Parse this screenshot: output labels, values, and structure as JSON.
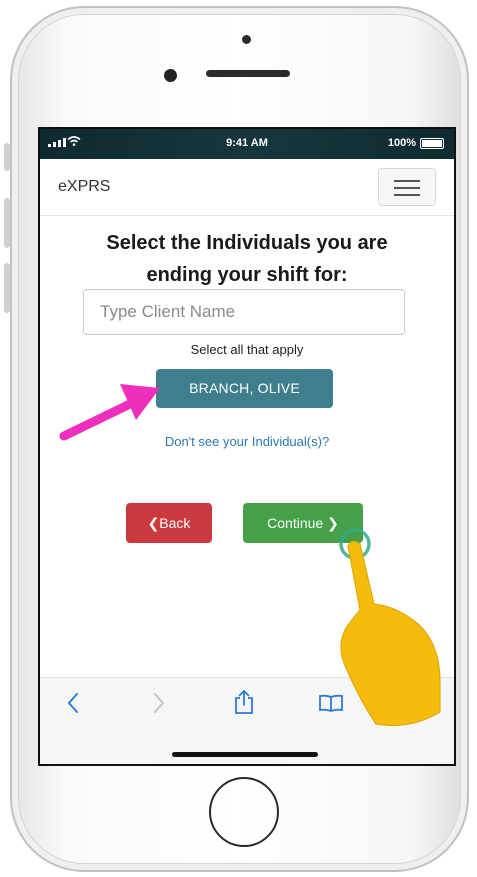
{
  "status_bar": {
    "time": "9:41 AM",
    "battery": "100%"
  },
  "navbar": {
    "brand": "eXPRS"
  },
  "page": {
    "title_line1": "Select the Individuals you are",
    "title_line2": "ending your shift for:",
    "search_placeholder": "Type Client Name",
    "hint": "Select all that apply",
    "client_button": "BRANCH, OLIVE",
    "missing_link": "Don't see your Individual(s)?",
    "back_label": "Back",
    "continue_label": "Continue"
  },
  "colors": {
    "client_button": "#3f7f8d",
    "back_button": "#c9393e",
    "continue_button": "#45a048",
    "link": "#2a78b8",
    "arrow_annotation": "#ee2fbe",
    "pointer_hand": "#f5bc0e"
  },
  "icons": {
    "toolbar": [
      "chevron-left-icon",
      "chevron-right-icon",
      "share-icon",
      "book-icon"
    ],
    "annotations": [
      "pink-arrow-icon",
      "pointing-hand-icon"
    ]
  }
}
